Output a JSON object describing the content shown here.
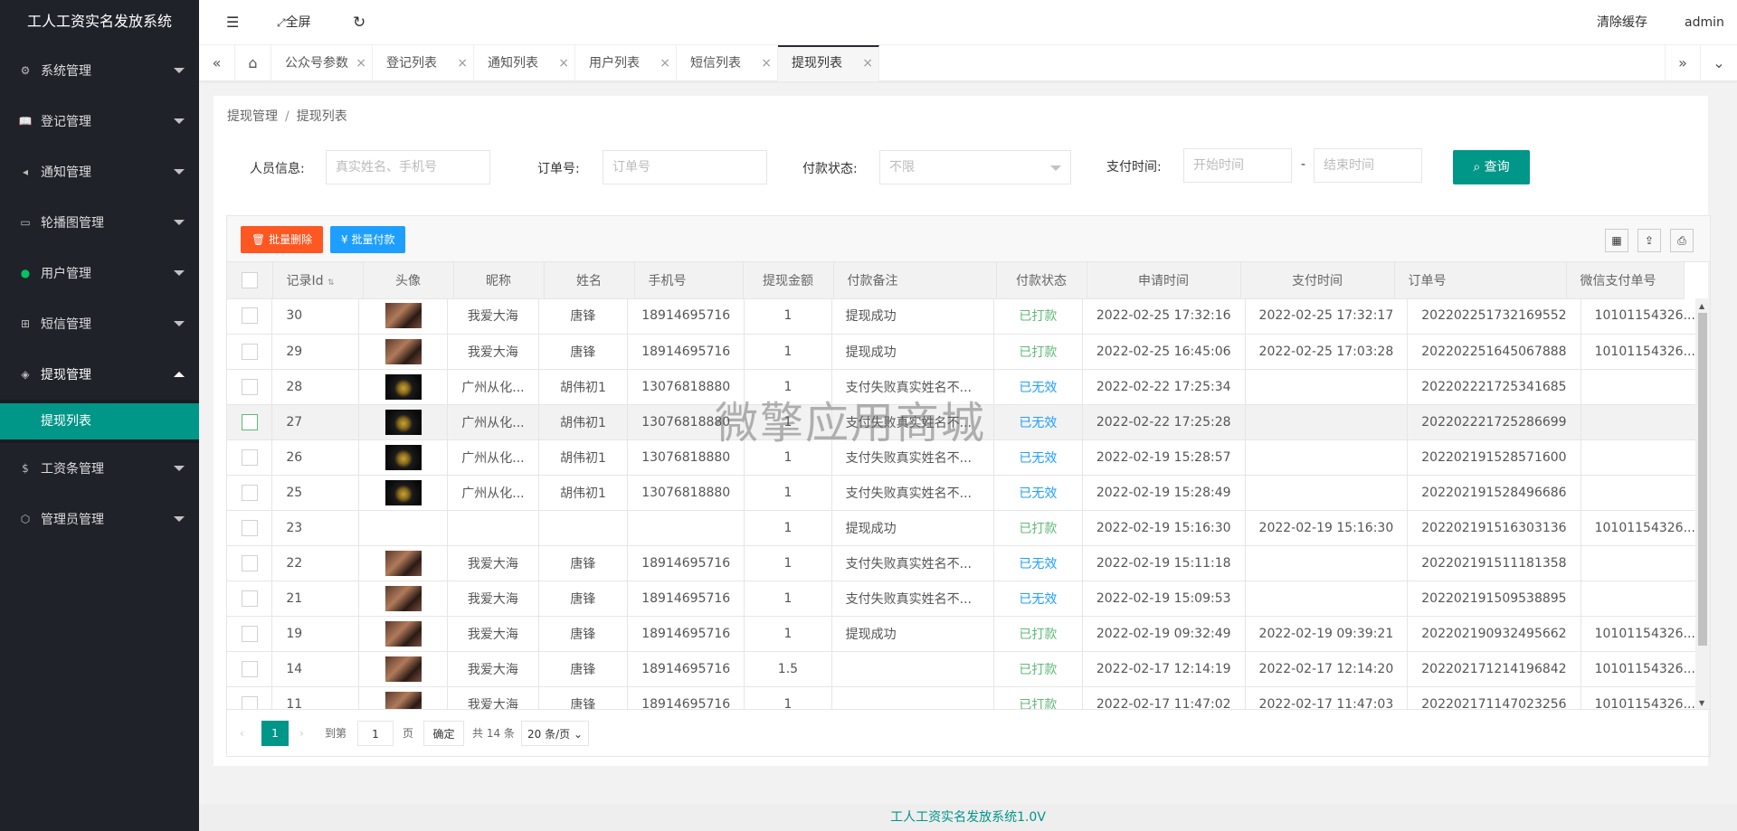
{
  "app": {
    "title": "工人工资实名发放系统",
    "footer": "工人工资实名发放系统1.0V",
    "watermark": "微擎应用商城"
  },
  "sidebar": {
    "menus": [
      {
        "label": "系统管理",
        "icon": "gear-icon"
      },
      {
        "label": "登记管理",
        "icon": "book-icon"
      },
      {
        "label": "通知管理",
        "icon": "speaker-icon"
      },
      {
        "label": "轮播图管理",
        "icon": "image-icon"
      },
      {
        "label": "用户管理",
        "icon": "wechat-icon"
      },
      {
        "label": "短信管理",
        "icon": "apps-icon"
      },
      {
        "label": "提现管理",
        "icon": "layers-icon"
      },
      {
        "label": "工资条管理",
        "icon": "dollar-icon"
      },
      {
        "label": "管理员管理",
        "icon": "cube-icon"
      }
    ],
    "active_sub": "提现列表"
  },
  "header": {
    "fullscreen": "全屏",
    "clear_cache": "清除缓存",
    "user": "admin"
  },
  "tabs": [
    "公众号参数",
    "登记列表",
    "通知列表",
    "用户列表",
    "短信列表",
    "提现列表"
  ],
  "breadcrumb": {
    "parent": "提现管理",
    "current": "提现列表"
  },
  "search": {
    "person_label": "人员信息:",
    "person_ph": "真实姓名、手机号",
    "order_label": "订单号:",
    "order_ph": "订单号",
    "status_label": "付款状态:",
    "status_value": "不限",
    "time_label": "支付时间:",
    "start_ph": "开始时间",
    "dash": "-",
    "end_ph": "结束时间",
    "query": "查询"
  },
  "toolbar": {
    "batch_delete": "批量删除",
    "batch_pay": "批量付款"
  },
  "table": {
    "columns": [
      "记录Id",
      "头像",
      "昵称",
      "姓名",
      "手机号",
      "提现金额",
      "付款备注",
      "付款状态",
      "申请时间",
      "支付时间",
      "订单号",
      "微信支付单号"
    ],
    "rows": [
      [
        "30",
        "p",
        "我爱大海",
        "唐锋",
        "18914695716",
        "1",
        "提现成功",
        "已打款",
        "2022-02-25 17:32:16",
        "2022-02-25 17:32:17",
        "202202251732169552",
        "10101154326..."
      ],
      [
        "29",
        "p",
        "我爱大海",
        "唐锋",
        "18914695716",
        "1",
        "提现成功",
        "已打款",
        "2022-02-25 16:45:06",
        "2022-02-25 17:03:28",
        "202202251645067888",
        "10101154326..."
      ],
      [
        "28",
        "d",
        "广州从化...",
        "胡伟初1",
        "13076818880",
        "1",
        "支付失败真实姓名不...",
        "已无效",
        "2022-02-22 17:25:34",
        "",
        "202202221725341685",
        ""
      ],
      [
        "27",
        "d",
        "广州从化...",
        "胡伟初1",
        "13076818880",
        "1",
        "支付失败真实姓名不...",
        "已无效",
        "2022-02-22 17:25:28",
        "",
        "202202221725286699",
        ""
      ],
      [
        "26",
        "d",
        "广州从化...",
        "胡伟初1",
        "13076818880",
        "1",
        "支付失败真实姓名不...",
        "已无效",
        "2022-02-19 15:28:57",
        "",
        "202202191528571600",
        ""
      ],
      [
        "25",
        "d",
        "广州从化...",
        "胡伟初1",
        "13076818880",
        "1",
        "支付失败真实姓名不...",
        "已无效",
        "2022-02-19 15:28:49",
        "",
        "202202191528496686",
        ""
      ],
      [
        "23",
        "",
        "",
        "",
        "",
        "1",
        "提现成功",
        "已打款",
        "2022-02-19 15:16:30",
        "2022-02-19 15:16:30",
        "202202191516303136",
        "10101154326..."
      ],
      [
        "22",
        "p",
        "我爱大海",
        "唐锋",
        "18914695716",
        "1",
        "支付失败真实姓名不...",
        "已无效",
        "2022-02-19 15:11:18",
        "",
        "202202191511181358",
        ""
      ],
      [
        "21",
        "p",
        "我爱大海",
        "唐锋",
        "18914695716",
        "1",
        "支付失败真实姓名不...",
        "已无效",
        "2022-02-19 15:09:53",
        "",
        "202202191509538895",
        ""
      ],
      [
        "19",
        "p",
        "我爱大海",
        "唐锋",
        "18914695716",
        "1",
        "提现成功",
        "已打款",
        "2022-02-19 09:32:49",
        "2022-02-19 09:39:21",
        "202202190932495662",
        "10101154326..."
      ],
      [
        "14",
        "p",
        "我爱大海",
        "唐锋",
        "18914695716",
        "1.5",
        "",
        "已打款",
        "2022-02-17 12:14:19",
        "2022-02-17 12:14:20",
        "202202171214196842",
        "10101154326..."
      ],
      [
        "11",
        "p",
        "我爱大海",
        "唐锋",
        "18914695716",
        "1",
        "",
        "已打款",
        "2022-02-17 11:47:02",
        "2022-02-17 11:47:03",
        "202202171147023256",
        "10101154326..."
      ]
    ]
  },
  "pager": {
    "page": "1",
    "goto": "到第",
    "page_unit": "页",
    "confirm": "确定",
    "total": "共 14 条",
    "size": "20 条/页"
  },
  "colors": {
    "accent": "#009688",
    "sidebar": "#20222a",
    "danger": "#ff5722",
    "info": "#1e9fff",
    "ok": "#5fb878"
  }
}
